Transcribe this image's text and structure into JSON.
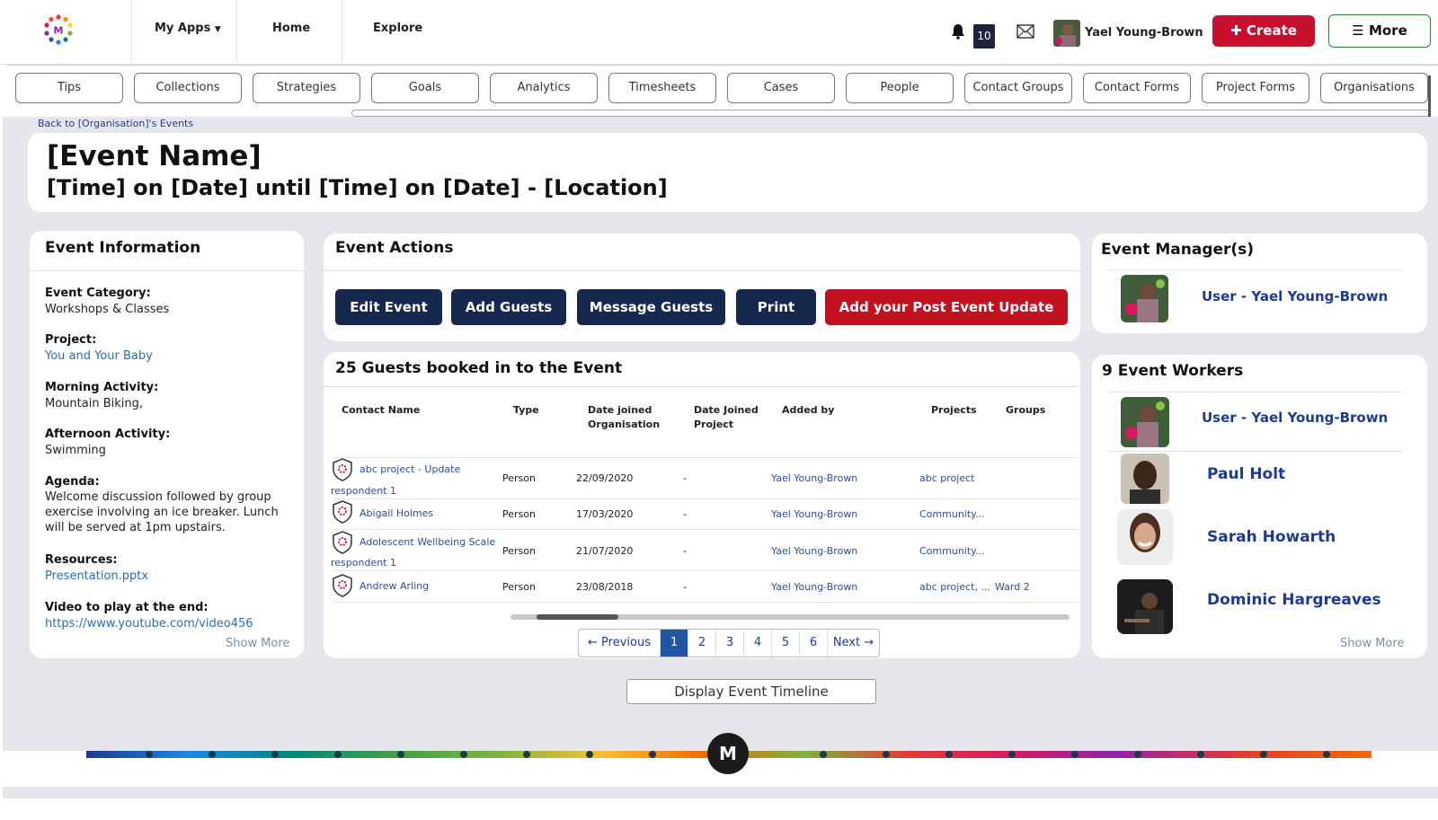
{
  "header": {
    "nav": [
      "My Apps",
      "Home",
      "Explore"
    ],
    "notification_count": "10",
    "user_name": "Yael Young-Brown",
    "create_label": "Create",
    "more_label": "More"
  },
  "tabs": [
    "Tips",
    "Collections",
    "Strategies",
    "Goals",
    "Analytics",
    "Timesheets",
    "Cases",
    "People",
    "Contact Groups",
    "Contact Forms",
    "Project Forms",
    "Organisations"
  ],
  "breadcrumb": "Back to [Organisation]'s Events",
  "event": {
    "name": "[Event Name]",
    "when": "[Time] on [Date] until [Time] on [Date] - [Location]"
  },
  "info": {
    "title": "Event Information",
    "category_label": "Event Category:",
    "category_value": "Workshops & Classes",
    "project_label": "Project:",
    "project_value": "You and Your Baby",
    "morning_label": "Morning Activity:",
    "morning_value": "Mountain Biking,",
    "afternoon_label": "Afternoon Activity:",
    "afternoon_value": "Swimming",
    "agenda_label": "Agenda:",
    "agenda_value": "Welcome discussion followed by group exercise involving an ice breaker. Lunch will be served at 1pm upstairs.",
    "resources_label": "Resources:",
    "resources_value": "Presentation.pptx",
    "video_label": "Video to play at the end:",
    "video_value": "https://www.youtube.com/video456",
    "show_more": "Show More"
  },
  "actions": {
    "title": "Event Actions",
    "edit": "Edit Event",
    "add_guests": "Add Guests",
    "message": "Message Guests",
    "print": "Print",
    "post_update": "Add your Post Event Update"
  },
  "guests": {
    "title": "25 Guests booked in to the Event",
    "headers": {
      "name": "Contact Name",
      "type": "Type",
      "date_org_1": "Date joined",
      "date_org_2": "Organisation",
      "date_proj_1": "Date Joined",
      "date_proj_2": "Project",
      "added_by": "Added by",
      "projects": "Projects",
      "groups": "Groups"
    },
    "rows": [
      {
        "name_1": "abc project - Update",
        "name_2": "respondent 1",
        "type": "Person",
        "date_org": "22/09/2020",
        "date_proj": "-",
        "added_by": "Yael Young-Brown",
        "projects": "abc project",
        "groups": ""
      },
      {
        "name_1": "Abigail Holmes",
        "name_2": "",
        "type": "Person",
        "date_org": "17/03/2020",
        "date_proj": "-",
        "added_by": "Yael Young-Brown",
        "projects": "Community...",
        "groups": ""
      },
      {
        "name_1": "Adolescent Wellbeing Scale",
        "name_2": "respondent 1",
        "type": "Person",
        "date_org": "21/07/2020",
        "date_proj": "-",
        "added_by": "Yael Young-Brown",
        "projects": "Community...",
        "groups": ""
      },
      {
        "name_1": "Andrew Arling",
        "name_2": "",
        "type": "Person",
        "date_org": "23/08/2018",
        "date_proj": "-",
        "added_by": "Yael Young-Brown",
        "projects": "abc project, ...",
        "groups": "Ward 2"
      }
    ],
    "pager": {
      "previous": "← Previous",
      "pages": [
        "1",
        "2",
        "3",
        "4",
        "5",
        "6"
      ],
      "active_page": "1",
      "next": "Next →"
    }
  },
  "managers": {
    "title": "Event Manager(s)",
    "name": "User - Yael Young-Brown"
  },
  "workers": {
    "title": "9 Event Workers",
    "names": [
      "User - Yael Young-Brown",
      "Paul Holt",
      "Sarah Howarth",
      "Dominic Hargreaves"
    ],
    "show_more": "Show More"
  },
  "timeline_button": "Display Event Timeline",
  "footer_logo": "M",
  "colors": {
    "navy": "#17284f",
    "red": "#c1121f",
    "link": "#1f3a93",
    "background": "#e6e7ec"
  }
}
